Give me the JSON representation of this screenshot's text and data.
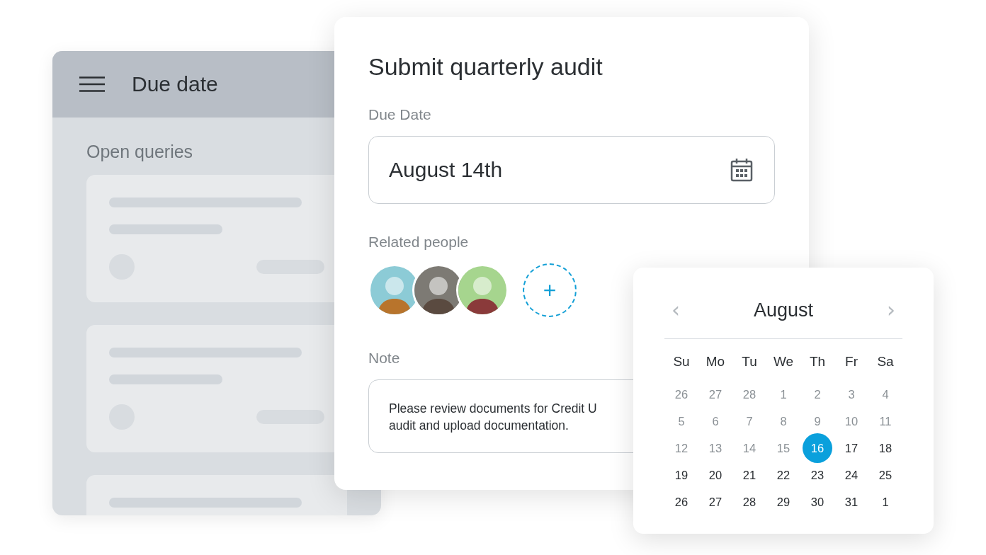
{
  "back_panel": {
    "title": "Due date",
    "section_title": "Open queries"
  },
  "dialog": {
    "title": "Submit quarterly audit",
    "due_date": {
      "label": "Due Date",
      "value": "August 14th"
    },
    "related_people": {
      "label": "Related people",
      "avatars": [
        {
          "kind": "photo"
        },
        {
          "kind": "photo"
        },
        {
          "kind": "photo"
        }
      ],
      "add_icon": "+"
    },
    "note": {
      "label": "Note",
      "lines": [
        "Please review documents for Credit U",
        "audit and upload documentation."
      ]
    }
  },
  "calendar": {
    "month": "August",
    "prev": "‹",
    "next": "›",
    "weekdays": [
      "Su",
      "Mo",
      "Tu",
      "We",
      "Th",
      "Fr",
      "Sa"
    ],
    "days": [
      {
        "label": "26",
        "muted": true,
        "selected": false
      },
      {
        "label": "27",
        "muted": true,
        "selected": false
      },
      {
        "label": "28",
        "muted": true,
        "selected": false
      },
      {
        "label": "1",
        "muted": true,
        "selected": false
      },
      {
        "label": "2",
        "muted": true,
        "selected": false
      },
      {
        "label": "3",
        "muted": true,
        "selected": false
      },
      {
        "label": "4",
        "muted": true,
        "selected": false
      },
      {
        "label": "5",
        "muted": true,
        "selected": false
      },
      {
        "label": "6",
        "muted": true,
        "selected": false
      },
      {
        "label": "7",
        "muted": true,
        "selected": false
      },
      {
        "label": "8",
        "muted": true,
        "selected": false
      },
      {
        "label": "9",
        "muted": true,
        "selected": false
      },
      {
        "label": "10",
        "muted": true,
        "selected": false
      },
      {
        "label": "11",
        "muted": true,
        "selected": false
      },
      {
        "label": "12",
        "muted": true,
        "selected": false
      },
      {
        "label": "13",
        "muted": true,
        "selected": false
      },
      {
        "label": "14",
        "muted": true,
        "selected": false
      },
      {
        "label": "15",
        "muted": true,
        "selected": false
      },
      {
        "label": "16",
        "muted": false,
        "selected": true
      },
      {
        "label": "17",
        "muted": false,
        "selected": false
      },
      {
        "label": "18",
        "muted": false,
        "selected": false
      },
      {
        "label": "19",
        "muted": false,
        "selected": false
      },
      {
        "label": "20",
        "muted": false,
        "selected": false
      },
      {
        "label": "21",
        "muted": false,
        "selected": false
      },
      {
        "label": "22",
        "muted": false,
        "selected": false
      },
      {
        "label": "23",
        "muted": false,
        "selected": false
      },
      {
        "label": "24",
        "muted": false,
        "selected": false
      },
      {
        "label": "25",
        "muted": false,
        "selected": false
      },
      {
        "label": "26",
        "muted": false,
        "selected": false
      },
      {
        "label": "27",
        "muted": false,
        "selected": false
      },
      {
        "label": "28",
        "muted": false,
        "selected": false
      },
      {
        "label": "29",
        "muted": false,
        "selected": false
      },
      {
        "label": "30",
        "muted": false,
        "selected": false
      },
      {
        "label": "31",
        "muted": false,
        "selected": false
      },
      {
        "label": "1",
        "muted": false,
        "selected": false
      }
    ]
  }
}
